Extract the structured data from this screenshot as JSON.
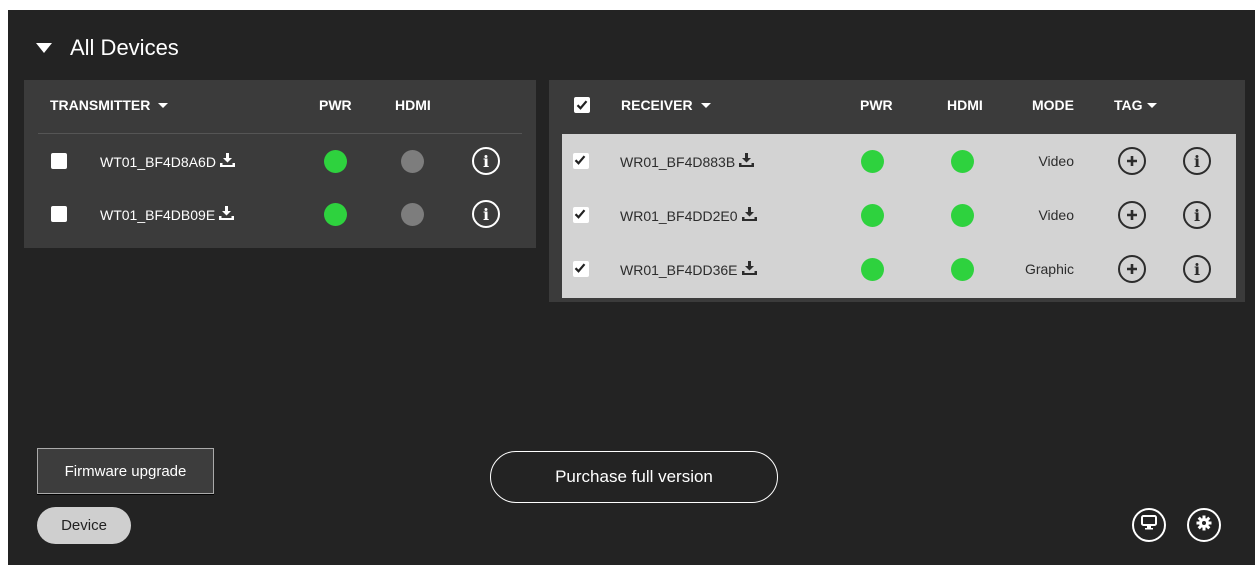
{
  "section": {
    "title": "All Devices"
  },
  "transmitter": {
    "header": {
      "name": "TRANSMITTER",
      "pwr": "PWR",
      "hdmi": "HDMI"
    },
    "rows": [
      {
        "name": "WT01_BF4D8A6D",
        "checked": false,
        "pwr": "on",
        "hdmi": "off"
      },
      {
        "name": "WT01_BF4DB09E",
        "checked": false,
        "pwr": "on",
        "hdmi": "off"
      }
    ]
  },
  "receiver": {
    "header": {
      "name": "RECEIVER",
      "pwr": "PWR",
      "hdmi": "HDMI",
      "mode": "MODE",
      "tag": "TAG"
    },
    "select_all_checked": true,
    "rows": [
      {
        "name": "WR01_BF4D883B",
        "checked": true,
        "pwr": "on",
        "hdmi": "on",
        "mode": "Video"
      },
      {
        "name": "WR01_BF4DD2E0",
        "checked": true,
        "pwr": "on",
        "hdmi": "on",
        "mode": "Video"
      },
      {
        "name": "WR01_BF4DD36E",
        "checked": true,
        "pwr": "on",
        "hdmi": "on",
        "mode": "Graphic"
      }
    ]
  },
  "footer": {
    "firmware_label": "Firmware upgrade",
    "device_label": "Device",
    "purchase_label": "Purchase full version"
  },
  "colors": {
    "status_on": "#2ed23e",
    "status_off": "#7d7d7d",
    "background": "#232323",
    "panel": "#3b3b3b"
  }
}
